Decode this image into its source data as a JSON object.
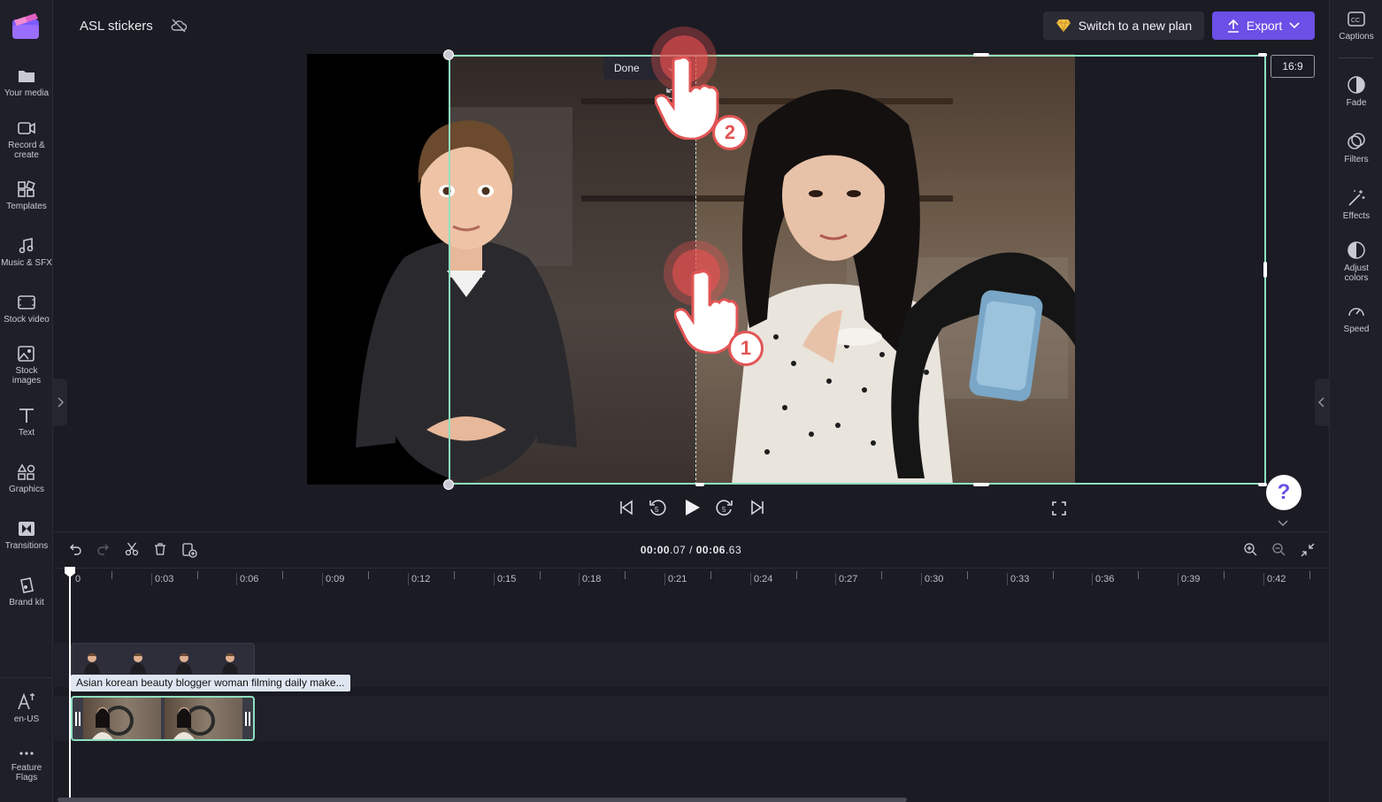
{
  "header": {
    "project_title": "ASL stickers",
    "plan_button": "Switch to a new plan",
    "export_button": "Export"
  },
  "left_nav": [
    {
      "label": "Your media",
      "icon": "folder-icon"
    },
    {
      "label": "Record & create",
      "icon": "camera-icon"
    },
    {
      "label": "Templates",
      "icon": "templates-icon"
    },
    {
      "label": "Music & SFX",
      "icon": "music-icon"
    },
    {
      "label": "Stock video",
      "icon": "film-icon"
    },
    {
      "label": "Stock images",
      "icon": "image-icon"
    },
    {
      "label": "Text",
      "icon": "text-icon"
    },
    {
      "label": "Graphics",
      "icon": "shapes-icon"
    },
    {
      "label": "Transitions",
      "icon": "transitions-icon"
    },
    {
      "label": "Brand kit",
      "icon": "brand-icon"
    }
  ],
  "left_bottom": [
    {
      "label": "en-US",
      "icon": "language-icon"
    },
    {
      "label": "Feature Flags",
      "icon": "more-icon"
    }
  ],
  "right_nav": [
    {
      "label": "Captions",
      "icon": "captions-icon"
    },
    {
      "label": "Fade",
      "icon": "fade-icon"
    },
    {
      "label": "Filters",
      "icon": "filters-icon"
    },
    {
      "label": "Effects",
      "icon": "effects-icon"
    },
    {
      "label": "Adjust colors",
      "icon": "adjust-colors-icon"
    },
    {
      "label": "Speed",
      "icon": "speed-icon"
    }
  ],
  "preview": {
    "aspect_ratio": "16:9",
    "crop_done_label": "Done",
    "help_label": "?"
  },
  "pointers": [
    {
      "number": "1"
    },
    {
      "number": "2"
    }
  ],
  "timeline": {
    "current_time_main": "00:00",
    "current_time_frac": ".07",
    "separator": " / ",
    "total_time_main": "00:06",
    "total_time_frac": ".63",
    "ruler_labels": [
      "0",
      "0:03",
      "0:06",
      "0:09",
      "0:12",
      "0:15",
      "0:18",
      "0:21",
      "0:24",
      "0:27",
      "0:30",
      "0:33",
      "0:36",
      "0:39",
      "0:42"
    ],
    "clip_label": "Asian korean beauty blogger woman filming daily make..."
  },
  "colors": {
    "accent": "#6b4fe6",
    "crop_border": "#8ee0c0",
    "pointer": "#e25555"
  }
}
